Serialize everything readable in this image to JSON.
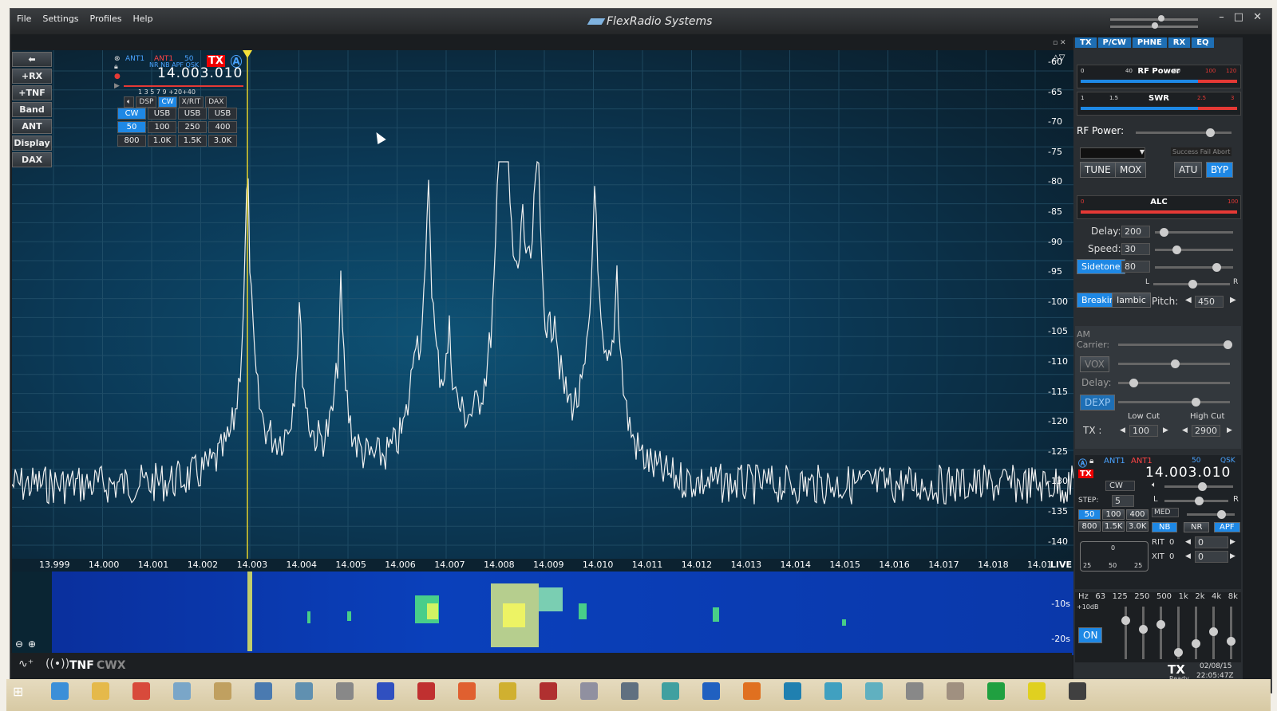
{
  "menu": [
    "File",
    "Settings",
    "Profiles",
    "Help"
  ],
  "app_title": "FlexRadio Systems",
  "window_controls": [
    "–",
    "□",
    "✕"
  ],
  "left_buttons": [
    "+RX",
    "+TNF",
    "Band",
    "ANT",
    "Display",
    "DAX"
  ],
  "slice": {
    "ant_rx": "ANT1",
    "ant_tx": "ANT1",
    "filter": "50",
    "flags": "NR NB APF QSK",
    "tx_badge": "TX",
    "slice_letter": "A",
    "frequency": "14.003.010",
    "s_scale": "1  3  5  7  9 +20+40",
    "tabs": [
      "DSP",
      "CW",
      "X/RIT",
      "DAX"
    ],
    "active_tab": "CW",
    "mode": "CW",
    "filter_row1": [
      "CW",
      "USB",
      "USB",
      "USB"
    ],
    "filter_row2": [
      "50",
      "100",
      "250",
      "400"
    ],
    "filter_row3": [
      "800",
      "1.0K",
      "1.5K",
      "3.0K"
    ]
  },
  "db_scale": [
    "-60",
    "-65",
    "-70",
    "-75",
    "-80",
    "-85",
    "-90",
    "-95",
    "-100",
    "-105",
    "-110",
    "-115",
    "-120",
    "-125",
    "-130",
    "-135",
    "-140"
  ],
  "freq_axis": [
    "13.999",
    "14.000",
    "14.001",
    "14.002",
    "14.003",
    "14.004",
    "14.005",
    "14.006",
    "14.007",
    "14.008",
    "14.009",
    "14.010",
    "14.011",
    "14.012",
    "14.013",
    "14.014",
    "14.015",
    "14.016",
    "14.017",
    "14.018",
    "14.01"
  ],
  "live_label": "LIVE",
  "waterfall_labels": [
    "-10s",
    "-20s"
  ],
  "bottom": {
    "tnf": "TNF",
    "cwx": "CWX"
  },
  "right_panel": {
    "tabs": [
      "TX",
      "P/CW",
      "PHNE",
      "RX",
      "EQ"
    ],
    "rf_power_meter": {
      "label": "RF Power",
      "ticks": [
        "0",
        "40",
        "80",
        "100",
        "120"
      ]
    },
    "swr_meter": {
      "label": "SWR",
      "ticks": [
        "1",
        "1.5",
        "2.5",
        "3"
      ]
    },
    "rf_power_label": "RF Power:",
    "atu_status": "Success Fail Abort",
    "buttons_tx": [
      "TUNE",
      "MOX",
      "ATU",
      "BYP"
    ],
    "alc_meter": {
      "label": "ALC",
      "ticks": [
        "0",
        "100"
      ]
    },
    "delay_label": "Delay:",
    "delay_value": "200",
    "speed_label": "Speed:",
    "speed_value": "30",
    "sidetone_label": "Sidetone",
    "sidetone_value": "80",
    "pan_l": "L",
    "pan_r": "R",
    "breakin": "Breakin",
    "iambic": "Iambic",
    "pitch_label": "Pitch:",
    "pitch_value": "450",
    "am_carrier": "AM Carrier:",
    "vox": "VOX",
    "vox_delay": "Delay:",
    "dexp": "DEXP",
    "low_cut": "Low Cut",
    "high_cut": "High Cut",
    "tx_label": "TX :",
    "low_cut_value": "100",
    "high_cut_value": "2900",
    "slice2": {
      "ant_rx": "ANT1",
      "ant_tx": "ANT1",
      "filter": "50",
      "qsk": "QSK",
      "frequency": "14.003.010",
      "mode": "CW",
      "step_label": "STEP:",
      "step_value": "5",
      "filters1": [
        "50",
        "100",
        "400"
      ],
      "filters2": [
        "800",
        "1.5K",
        "3.0K"
      ],
      "agc": "MED",
      "nb": "NB",
      "nr": "NR",
      "apf": "APF",
      "rit_label": "RIT",
      "rit_value": "0",
      "rit_offset": "0",
      "xit_label": "XIT",
      "xit_value": "0",
      "xit_offset": "0",
      "apf_scale": [
        "25",
        "50",
        "25"
      ],
      "apf_center": "0"
    },
    "eq": {
      "bands": [
        "Hz",
        "63",
        "125",
        "250",
        "500",
        "1k",
        "2k",
        "4k",
        "8k"
      ],
      "gain_label": "+10dB",
      "on": "ON",
      "levels": [
        0.8,
        0.6,
        0.7,
        0.1,
        0.3,
        0.55,
        0.35
      ]
    }
  },
  "status": {
    "tx": "TX",
    "ready": "Ready",
    "date": "02/08/15",
    "time": "22:05:47Z"
  }
}
